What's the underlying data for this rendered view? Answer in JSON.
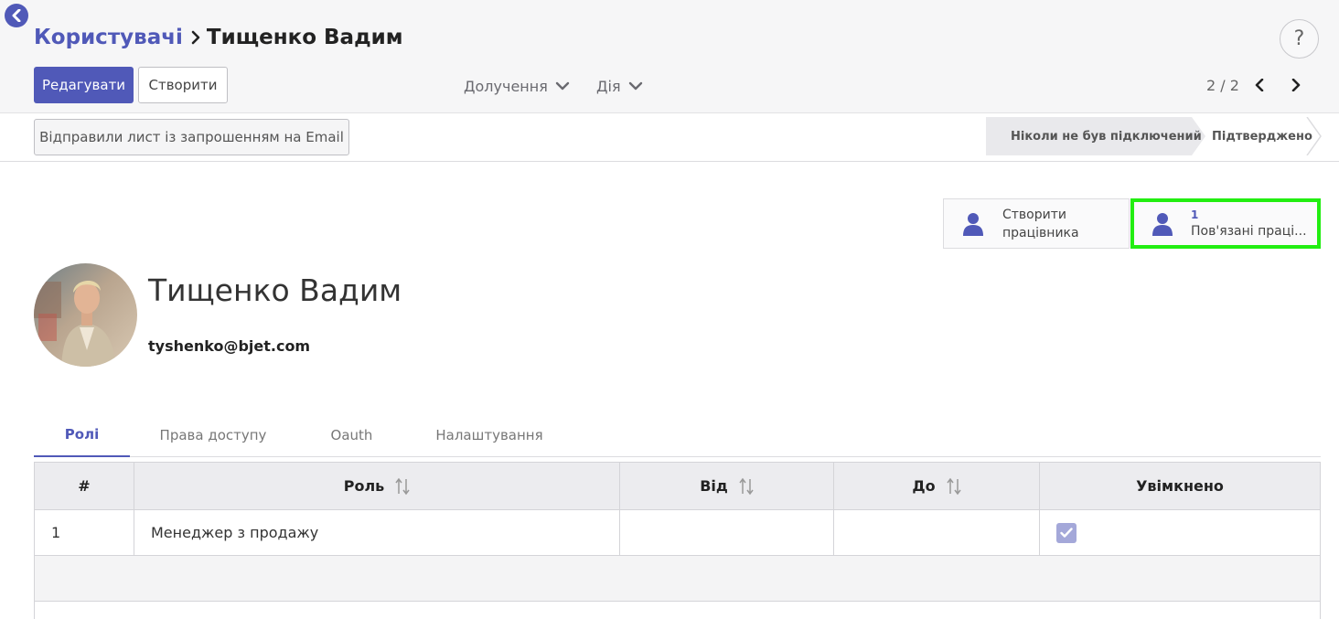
{
  "breadcrumb": {
    "parent": "Користувачі",
    "current": "Тищенко Вадим"
  },
  "help": {
    "label": "?"
  },
  "toolbar": {
    "edit_label": "Редагувати",
    "create_label": "Створити",
    "attach_label": "Долучення",
    "action_label": "Дія"
  },
  "pager": {
    "value": "2 / 2"
  },
  "status_bar": {
    "invite_label": "Відправили лист із запрошенням на Email",
    "states": [
      "Ніколи не був підключений",
      "Підтверджено"
    ]
  },
  "smart_buttons": {
    "create_employee": {
      "line1": "Створити",
      "line2": "працівника"
    },
    "related_employees": {
      "count": "1",
      "label": "Пов'язані працівники"
    }
  },
  "user": {
    "name": "Тищенко Вадим",
    "email": "tyshenko@bjet.com"
  },
  "tabs": [
    "Ролі",
    "Права доступу",
    "Oauth",
    "Налаштування"
  ],
  "grid": {
    "columns": [
      "#",
      "Роль",
      "Від",
      "До",
      "Увімкнено"
    ],
    "rows": [
      {
        "num": "1",
        "role": "Менеджер з продажу",
        "from": "",
        "to": "",
        "enabled": true
      }
    ]
  },
  "colors": {
    "accent": "#5059b8",
    "highlight": "#22ee11"
  }
}
